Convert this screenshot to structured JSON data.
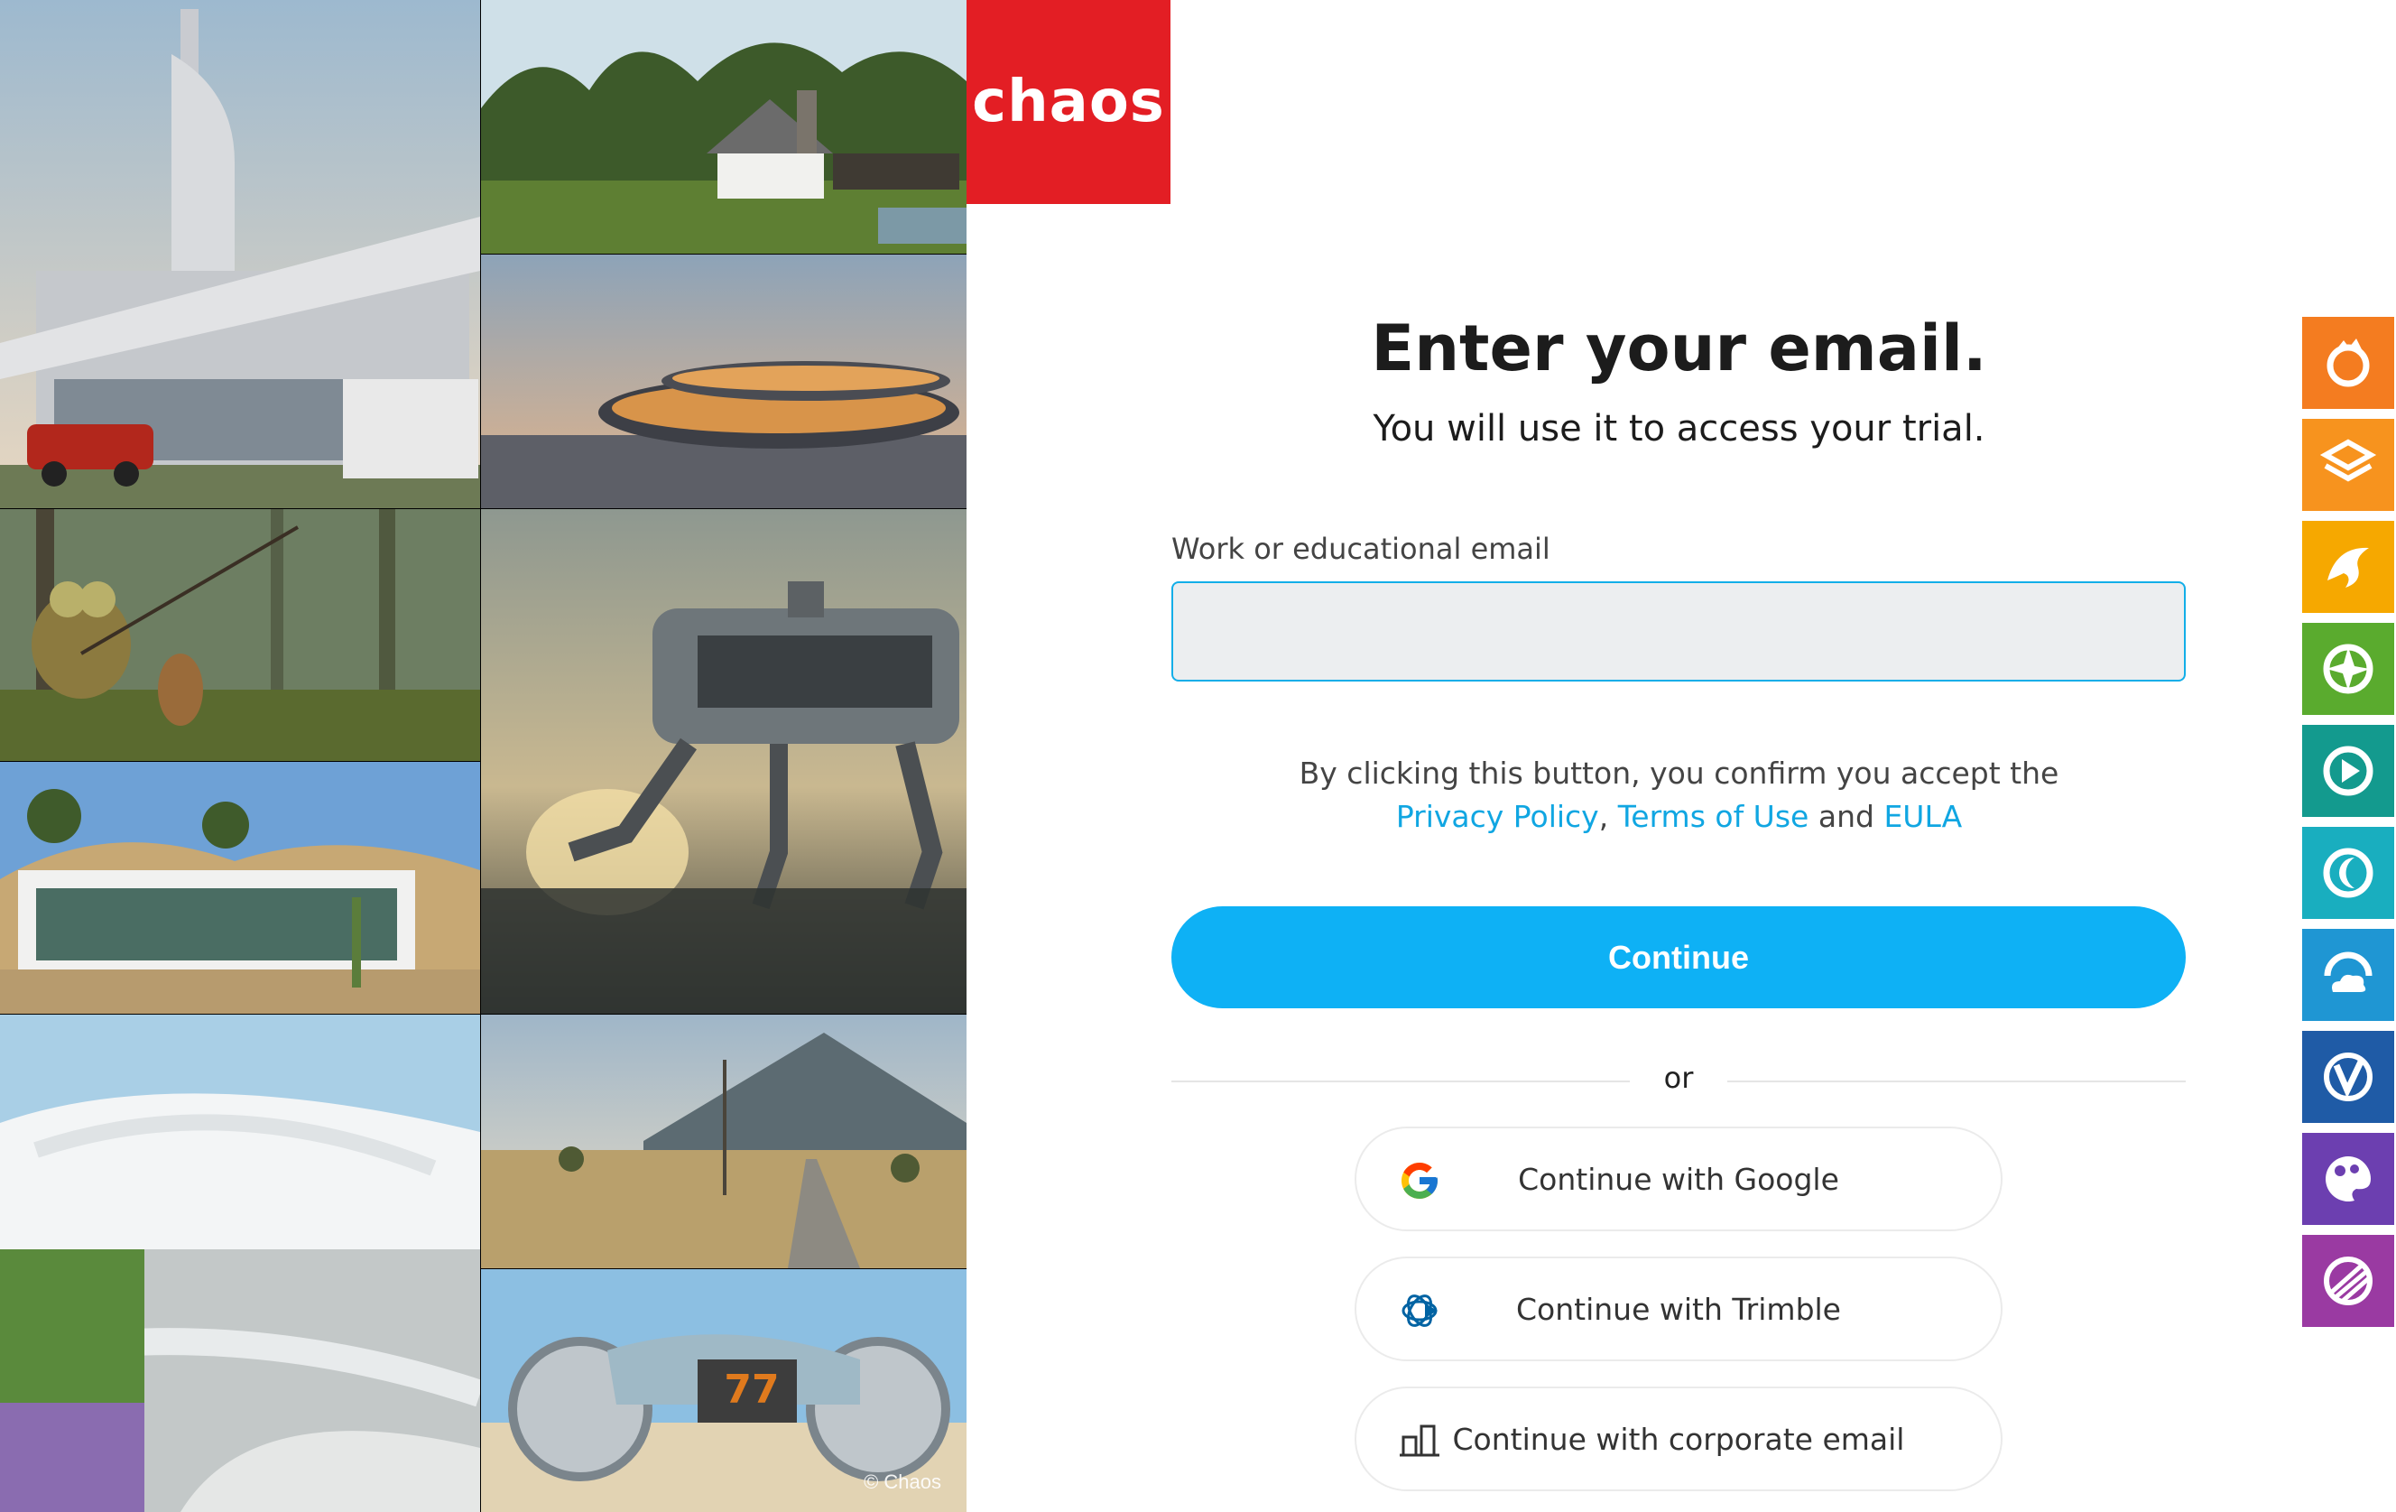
{
  "brand": {
    "logo_text": "chaos",
    "logo_color": "#e31e24"
  },
  "gallery": {
    "credit": "© Chaos"
  },
  "form": {
    "heading": "Enter your email.",
    "subheading": "You will use it to access your trial.",
    "email_label": "Work or educational email",
    "email_value": "",
    "email_placeholder": "",
    "consent_text": "By clicking this button, you confirm you accept the",
    "privacy_link": "Privacy Policy",
    "comma": ",",
    "terms_link": "Terms of Use",
    "and_text": "and",
    "eula_link": "EULA",
    "continue_label": "Continue",
    "divider_text": "or"
  },
  "sso": [
    {
      "label": "Continue with Google",
      "icon": "google-icon"
    },
    {
      "label": "Continue with Trimble",
      "icon": "trimble-icon"
    },
    {
      "label": "Continue with corporate email",
      "icon": "building-icon"
    }
  ],
  "product_rail": [
    {
      "icon": "flame-product-icon",
      "color": "#f47c20"
    },
    {
      "icon": "layers-product-icon",
      "color": "#f7931e"
    },
    {
      "icon": "bird-product-icon",
      "color": "#f6a800"
    },
    {
      "icon": "aperture-product-icon",
      "color": "#5aab2e"
    },
    {
      "icon": "play-product-icon",
      "color": "#139a8e"
    },
    {
      "icon": "crescent-product-icon",
      "color": "#19aebf"
    },
    {
      "icon": "cloud-product-icon",
      "color": "#1f96d3"
    },
    {
      "icon": "v-product-icon",
      "color": "#1f5ba6"
    },
    {
      "icon": "palette-product-icon",
      "color": "#6c3fb0"
    },
    {
      "icon": "comet-product-icon",
      "color": "#9a3aa2"
    }
  ],
  "colors": {
    "accent": "#0eb1f5",
    "link": "#10a6e2"
  }
}
